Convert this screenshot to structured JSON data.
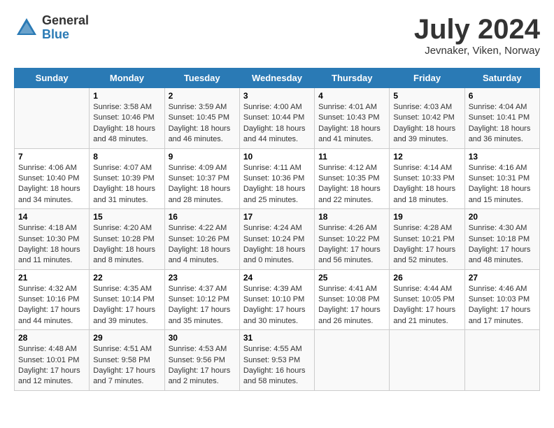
{
  "header": {
    "logo_line1": "General",
    "logo_line2": "Blue",
    "month_title": "July 2024",
    "location": "Jevnaker, Viken, Norway"
  },
  "columns": [
    "Sunday",
    "Monday",
    "Tuesday",
    "Wednesday",
    "Thursday",
    "Friday",
    "Saturday"
  ],
  "weeks": [
    [
      {
        "day": "",
        "info": ""
      },
      {
        "day": "1",
        "info": "Sunrise: 3:58 AM\nSunset: 10:46 PM\nDaylight: 18 hours\nand 48 minutes."
      },
      {
        "day": "2",
        "info": "Sunrise: 3:59 AM\nSunset: 10:45 PM\nDaylight: 18 hours\nand 46 minutes."
      },
      {
        "day": "3",
        "info": "Sunrise: 4:00 AM\nSunset: 10:44 PM\nDaylight: 18 hours\nand 44 minutes."
      },
      {
        "day": "4",
        "info": "Sunrise: 4:01 AM\nSunset: 10:43 PM\nDaylight: 18 hours\nand 41 minutes."
      },
      {
        "day": "5",
        "info": "Sunrise: 4:03 AM\nSunset: 10:42 PM\nDaylight: 18 hours\nand 39 minutes."
      },
      {
        "day": "6",
        "info": "Sunrise: 4:04 AM\nSunset: 10:41 PM\nDaylight: 18 hours\nand 36 minutes."
      }
    ],
    [
      {
        "day": "7",
        "info": "Sunrise: 4:06 AM\nSunset: 10:40 PM\nDaylight: 18 hours\nand 34 minutes."
      },
      {
        "day": "8",
        "info": "Sunrise: 4:07 AM\nSunset: 10:39 PM\nDaylight: 18 hours\nand 31 minutes."
      },
      {
        "day": "9",
        "info": "Sunrise: 4:09 AM\nSunset: 10:37 PM\nDaylight: 18 hours\nand 28 minutes."
      },
      {
        "day": "10",
        "info": "Sunrise: 4:11 AM\nSunset: 10:36 PM\nDaylight: 18 hours\nand 25 minutes."
      },
      {
        "day": "11",
        "info": "Sunrise: 4:12 AM\nSunset: 10:35 PM\nDaylight: 18 hours\nand 22 minutes."
      },
      {
        "day": "12",
        "info": "Sunrise: 4:14 AM\nSunset: 10:33 PM\nDaylight: 18 hours\nand 18 minutes."
      },
      {
        "day": "13",
        "info": "Sunrise: 4:16 AM\nSunset: 10:31 PM\nDaylight: 18 hours\nand 15 minutes."
      }
    ],
    [
      {
        "day": "14",
        "info": "Sunrise: 4:18 AM\nSunset: 10:30 PM\nDaylight: 18 hours\nand 11 minutes."
      },
      {
        "day": "15",
        "info": "Sunrise: 4:20 AM\nSunset: 10:28 PM\nDaylight: 18 hours\nand 8 minutes."
      },
      {
        "day": "16",
        "info": "Sunrise: 4:22 AM\nSunset: 10:26 PM\nDaylight: 18 hours\nand 4 minutes."
      },
      {
        "day": "17",
        "info": "Sunrise: 4:24 AM\nSunset: 10:24 PM\nDaylight: 18 hours\nand 0 minutes."
      },
      {
        "day": "18",
        "info": "Sunrise: 4:26 AM\nSunset: 10:22 PM\nDaylight: 17 hours\nand 56 minutes."
      },
      {
        "day": "19",
        "info": "Sunrise: 4:28 AM\nSunset: 10:21 PM\nDaylight: 17 hours\nand 52 minutes."
      },
      {
        "day": "20",
        "info": "Sunrise: 4:30 AM\nSunset: 10:18 PM\nDaylight: 17 hours\nand 48 minutes."
      }
    ],
    [
      {
        "day": "21",
        "info": "Sunrise: 4:32 AM\nSunset: 10:16 PM\nDaylight: 17 hours\nand 44 minutes."
      },
      {
        "day": "22",
        "info": "Sunrise: 4:35 AM\nSunset: 10:14 PM\nDaylight: 17 hours\nand 39 minutes."
      },
      {
        "day": "23",
        "info": "Sunrise: 4:37 AM\nSunset: 10:12 PM\nDaylight: 17 hours\nand 35 minutes."
      },
      {
        "day": "24",
        "info": "Sunrise: 4:39 AM\nSunset: 10:10 PM\nDaylight: 17 hours\nand 30 minutes."
      },
      {
        "day": "25",
        "info": "Sunrise: 4:41 AM\nSunset: 10:08 PM\nDaylight: 17 hours\nand 26 minutes."
      },
      {
        "day": "26",
        "info": "Sunrise: 4:44 AM\nSunset: 10:05 PM\nDaylight: 17 hours\nand 21 minutes."
      },
      {
        "day": "27",
        "info": "Sunrise: 4:46 AM\nSunset: 10:03 PM\nDaylight: 17 hours\nand 17 minutes."
      }
    ],
    [
      {
        "day": "28",
        "info": "Sunrise: 4:48 AM\nSunset: 10:01 PM\nDaylight: 17 hours\nand 12 minutes."
      },
      {
        "day": "29",
        "info": "Sunrise: 4:51 AM\nSunset: 9:58 PM\nDaylight: 17 hours\nand 7 minutes."
      },
      {
        "day": "30",
        "info": "Sunrise: 4:53 AM\nSunset: 9:56 PM\nDaylight: 17 hours\nand 2 minutes."
      },
      {
        "day": "31",
        "info": "Sunrise: 4:55 AM\nSunset: 9:53 PM\nDaylight: 16 hours\nand 58 minutes."
      },
      {
        "day": "",
        "info": ""
      },
      {
        "day": "",
        "info": ""
      },
      {
        "day": "",
        "info": ""
      }
    ]
  ]
}
